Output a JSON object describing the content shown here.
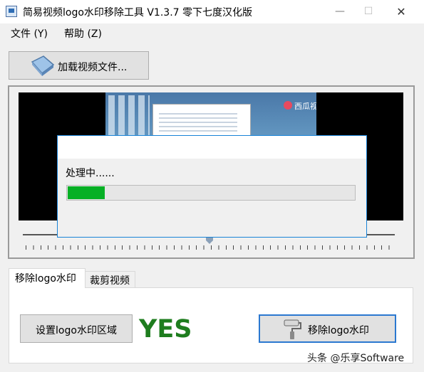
{
  "window": {
    "title": "简易视频logo水印移除工具 V1.3.7 零下七度汉化版",
    "minimize": "—",
    "maximize": "☐",
    "close": "✕"
  },
  "menu": [
    "文件 (Y)",
    "帮助 (Z)"
  ],
  "toolbar": {
    "load_label": "加载视频文件..."
  },
  "preview": {
    "watermark_text": "西瓜视频"
  },
  "dialog": {
    "label": "处理中......",
    "progress": 0.13
  },
  "tabs": [
    "移除logo水印",
    "裁剪视频"
  ],
  "panel": {
    "set_region_label": "设置logo水印区域",
    "status": "YES",
    "remove_label": "移除logo水印"
  },
  "credit": "头条 @乐享Software",
  "colors": {
    "progress": "#06b025",
    "status": "#1e7d1e",
    "focus_border": "#2b78d0"
  }
}
